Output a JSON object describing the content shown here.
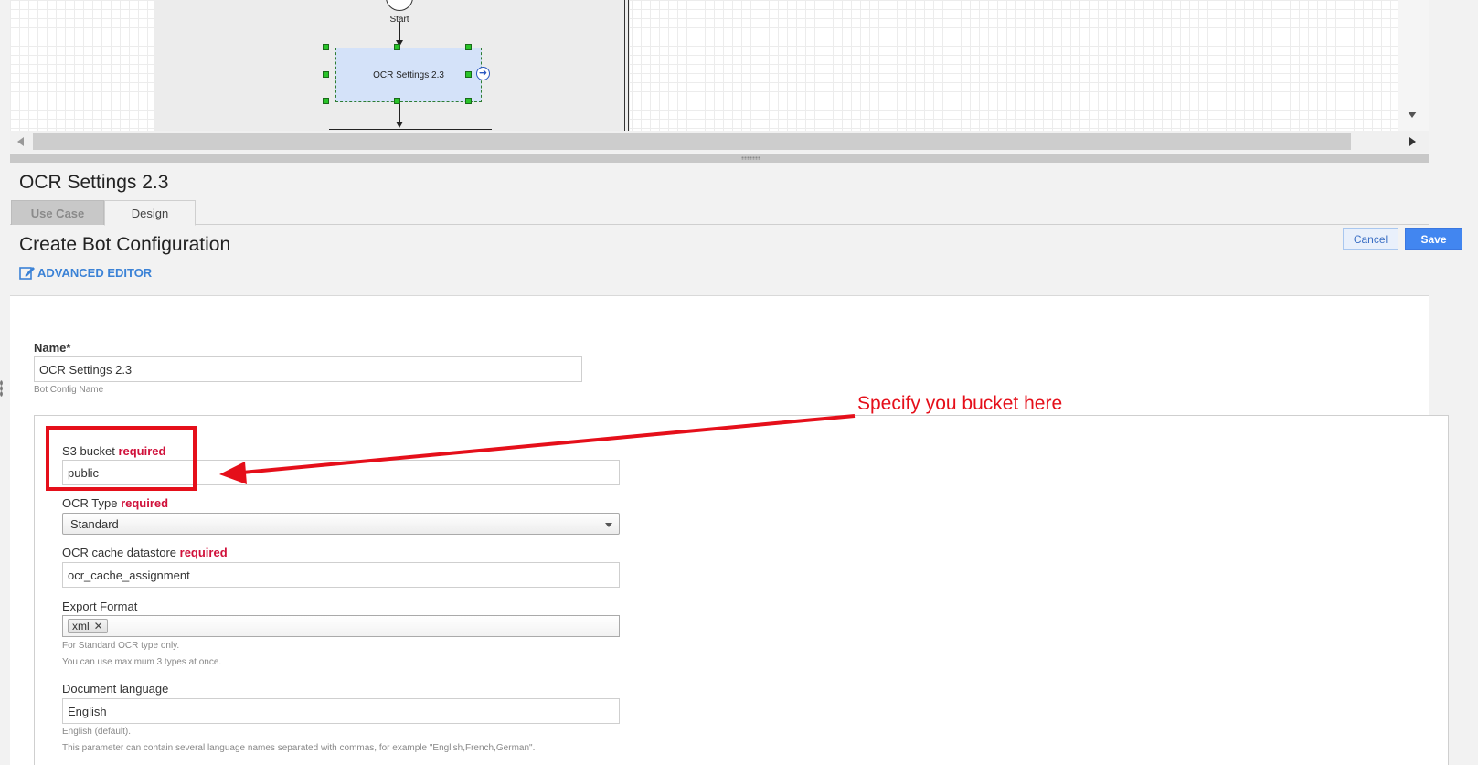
{
  "diagram": {
    "start_label": "Start",
    "task_label": "OCR Settings 2.3"
  },
  "panel": {
    "title": "OCR Settings 2.3",
    "tabs": [
      {
        "label": "Use Case",
        "active": false
      },
      {
        "label": "Design",
        "active": true
      }
    ],
    "section_title": "Create Bot Configuration",
    "advanced_editor_label": "ADVANCED EDITOR",
    "cancel_label": "Cancel",
    "save_label": "Save"
  },
  "form": {
    "name": {
      "label": "Name*",
      "value": "OCR Settings 2.3",
      "hint": "Bot Config Name"
    },
    "s3_bucket": {
      "label": "S3 bucket",
      "required_label": "required",
      "value": "public"
    },
    "ocr_type": {
      "label": "OCR Type",
      "required_label": "required",
      "selected": "Standard"
    },
    "ocr_cache": {
      "label": "OCR cache datastore",
      "required_label": "required",
      "value": "ocr_cache_assignment"
    },
    "export_format": {
      "label": "Export Format",
      "tags": [
        "xml"
      ],
      "hint_1": "For Standard OCR type only.",
      "hint_2": "You can use maximum 3 types at once."
    },
    "document_language": {
      "label": "Document language",
      "value": "English",
      "hint_1": "English (default).",
      "hint_2": "This parameter can contain several language names separated with commas, for example \"English,French,German\"."
    }
  },
  "annotation": {
    "text": "Specify you bucket here",
    "color": "#e50f1a"
  },
  "colors": {
    "accent": "#4286f0",
    "link": "#3b82d6",
    "required": "#d0103a"
  }
}
